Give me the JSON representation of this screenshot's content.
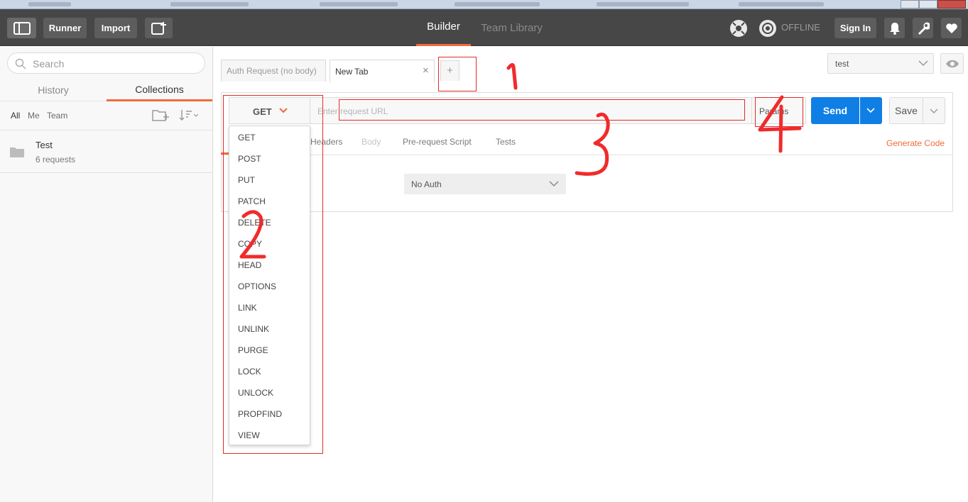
{
  "header": {
    "runner_label": "Runner",
    "import_label": "Import",
    "tabs": [
      {
        "label": "Builder",
        "active": true
      },
      {
        "label": "Team Library",
        "active": false
      }
    ],
    "offline_label": "OFFLINE",
    "signin_label": "Sign In"
  },
  "sidebar": {
    "search_placeholder": "Search",
    "tabs": [
      {
        "label": "History"
      },
      {
        "label": "Collections"
      }
    ],
    "filters": [
      "All",
      "Me",
      "Team"
    ],
    "collection": {
      "name": "Test",
      "meta": "6 requests"
    }
  },
  "main": {
    "tabs": [
      {
        "label": "Auth Request (no body)"
      },
      {
        "label": "New Tab",
        "close": "×"
      }
    ],
    "new_tab_label": "+",
    "environment": "test",
    "method": "GET",
    "url_placeholder": "Enter request URL",
    "params_label": "Params",
    "send_label": "Send",
    "save_label": "Save",
    "subtabs": [
      "Headers",
      "Body",
      "Pre-request Script",
      "Tests"
    ],
    "generate_code": "Generate Code",
    "auth_type": "No Auth",
    "methods": [
      "GET",
      "POST",
      "PUT",
      "PATCH",
      "DELETE",
      "COPY",
      "HEAD",
      "OPTIONS",
      "LINK",
      "UNLINK",
      "PURGE",
      "LOCK",
      "UNLOCK",
      "PROPFIND",
      "VIEW"
    ]
  },
  "colors": {
    "accent": "#f26b3a",
    "send_blue": "#0f7fe6",
    "header_bg": "#474747",
    "annotation_red": "#e32b2b"
  }
}
